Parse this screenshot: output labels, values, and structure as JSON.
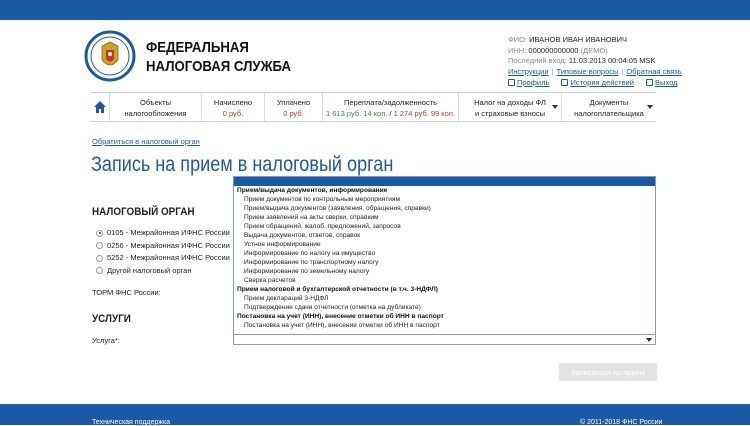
{
  "header": {
    "brand_line1": "ФЕДЕРАЛЬНАЯ",
    "brand_line2": "НАЛОГОВАЯ СЛУЖБА",
    "logo_icon": "fns-emblem-icon"
  },
  "user": {
    "fio_label": "ФИО:",
    "fio_value": "ИВАНОВ ИВАН ИВАНОВИЧ",
    "inn_label": "ИНН:",
    "inn_value": "000000000000",
    "inn_note": "(ДЕМО)",
    "last_login_label": "Последний вход:",
    "last_login_value": "11.03.2013 00:04:05 MSK",
    "link_instructions": "Инструкции",
    "link_faq": "Типовые вопросы",
    "link_feedback": "Обратная связь",
    "link_profile": "Профиль",
    "link_history": "История действий",
    "link_exit": "Выход"
  },
  "menu": {
    "home_icon": "home-icon",
    "items": [
      {
        "line1": "Объекты",
        "line2": "налогообложения"
      },
      {
        "line1": "Начислено",
        "value": "0 руб."
      },
      {
        "line1": "Уплачено",
        "value": "0 руб."
      },
      {
        "line1": "Переплата/задолженность",
        "value_green": "1 613 руб. 14 коп.",
        "value_sep": " / ",
        "value_red": "1 274 руб. 99 коп."
      },
      {
        "line1": "Налог на доходы ФЛ",
        "line2": "и страховые взносы"
      },
      {
        "line1": "Документы",
        "line2": "налогоплательщика"
      }
    ]
  },
  "breadcrumb": "Обратиться в налоговый орган",
  "page_title": "Запись на прием в налоговый орган",
  "section_tax_office": "НАЛОГОВЫЙ ОРГАН",
  "offices": [
    {
      "label": "0105 - Межрайонная ИФНС России",
      "selected": true
    },
    {
      "label": "0256 - Межрайонная ИФНС России",
      "selected": false
    },
    {
      "label": "5252 - Межрайонная ИФНС России",
      "selected": false
    },
    {
      "label": "Другой налоговый орган",
      "selected": false
    }
  ],
  "torm_label": "ТОРМ ФНС России:",
  "section_services": "УСЛУГИ",
  "service_label": "Услуга*:",
  "dropdown": {
    "groups": [
      {
        "title": "Прием/выдача документов, информирование",
        "options": [
          "Прием документов по контрольным мероприятиям",
          "Прием/выдача документов (заявления, обращения, справки)",
          "Прием заявлений на акты сверки, справким",
          "Прием обращений, жалоб, предложений, запросов",
          "Выдача документов, ответов, справок",
          "Устное информирование",
          "Информирование по налогу на имущество",
          "Информирование по транспортному налогу",
          "Информирование по земельному налогу",
          "Сверка расчетов"
        ]
      },
      {
        "title": "Прием налоговой и бухгалтерской отчетности (в т.ч. 3-НДФЛ)",
        "options": [
          "Прием деклараций 3-НДФЛ",
          "Подтверждение сдачи отчетности (отметка на дубликате)"
        ]
      },
      {
        "title": "Постановка на учет (ИНН), внесение отметки об ИНН в паспорт",
        "options": [
          "Постановка на учет (ИНН), внесение отметки об ИНН в паспорт"
        ]
      }
    ]
  },
  "submit_label": "Записаться на прием",
  "footer": {
    "support": "Техническая поддержка",
    "copyright": "© 2011-2018 ФНС России"
  }
}
